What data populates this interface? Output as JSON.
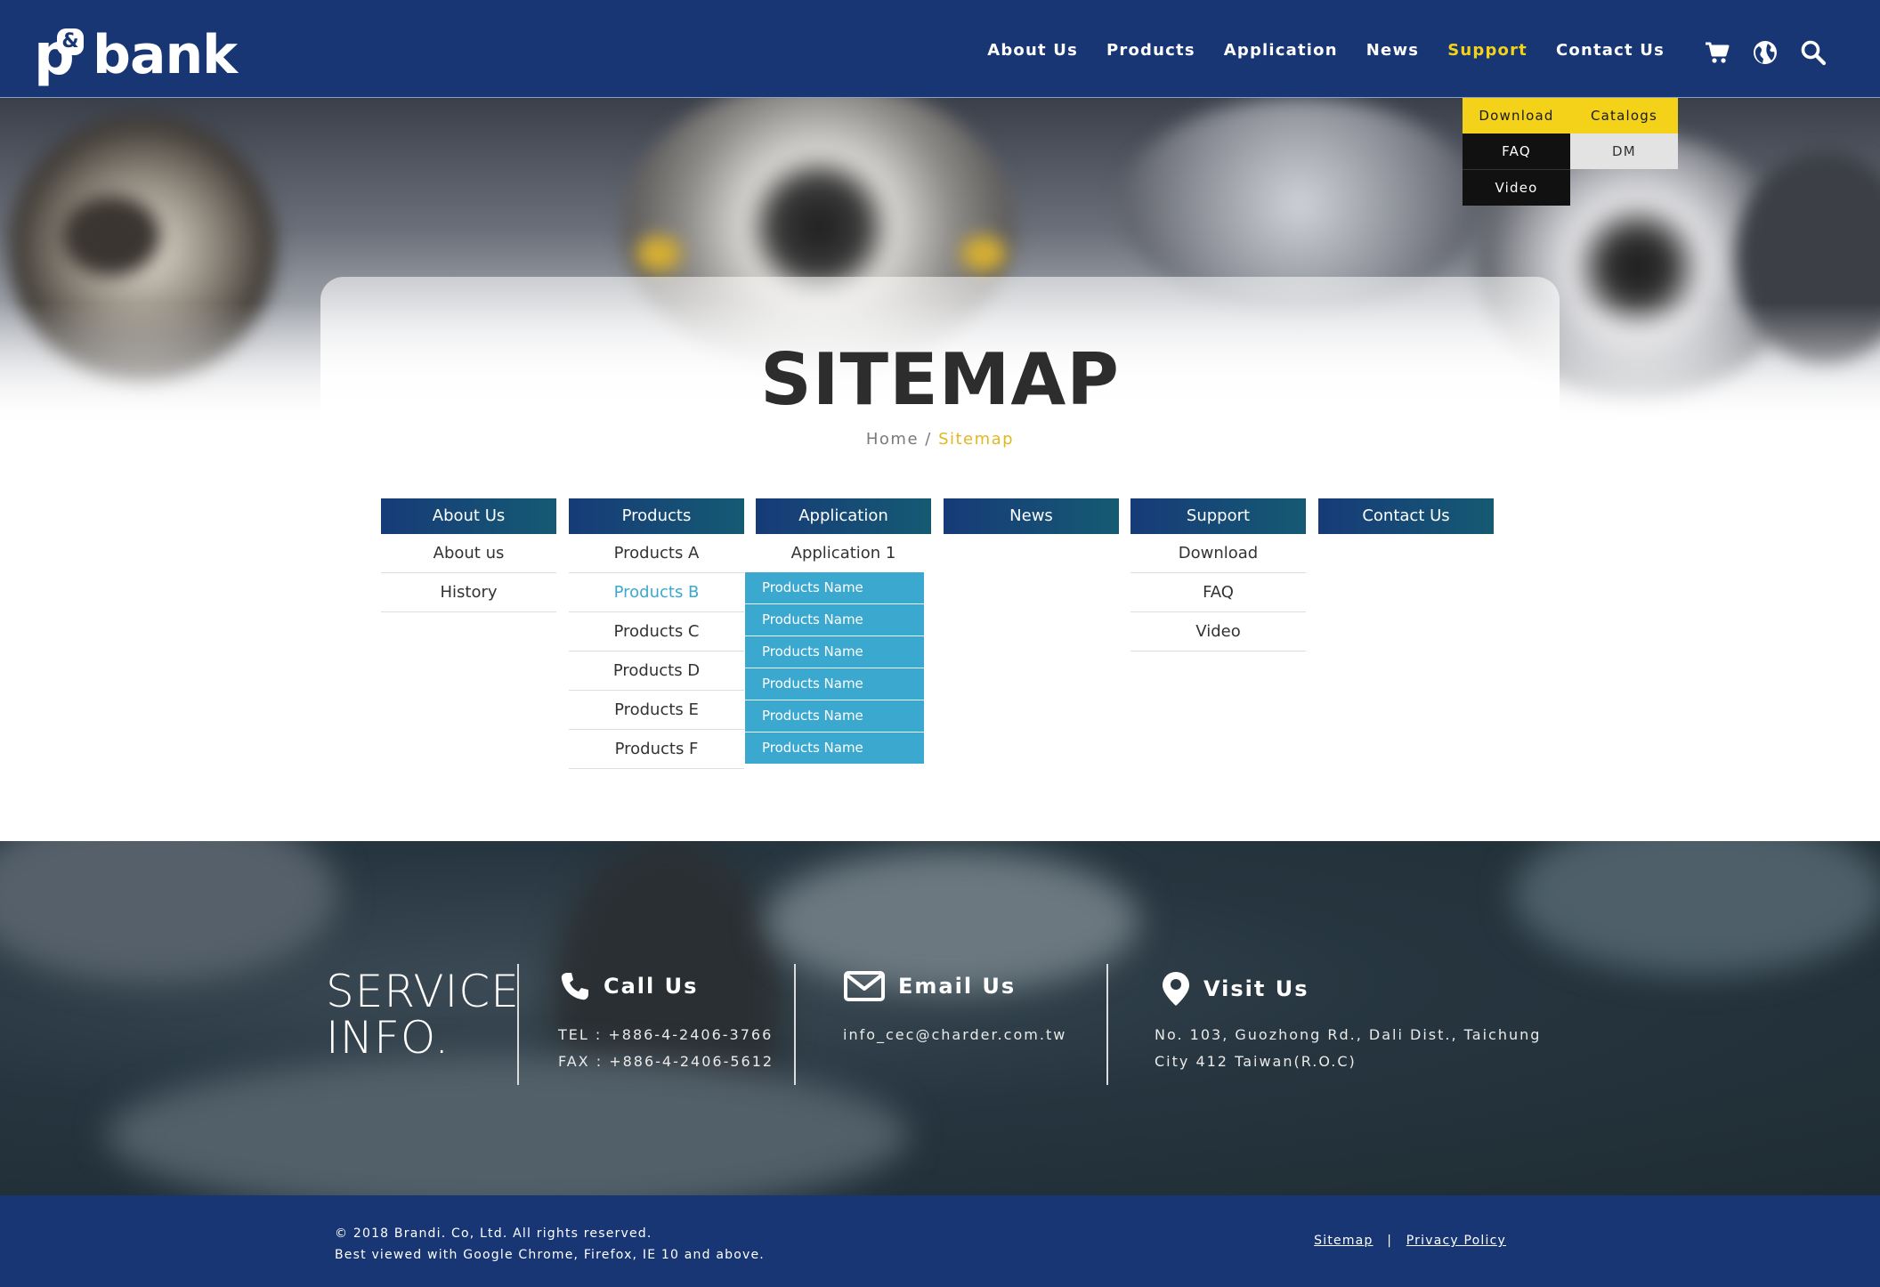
{
  "brand": {
    "logo_text": "bank",
    "logo_p": "p",
    "logo_amp": "&"
  },
  "nav": {
    "items": [
      {
        "label": "About Us"
      },
      {
        "label": "Products"
      },
      {
        "label": "Application"
      },
      {
        "label": "News"
      },
      {
        "label": "Support",
        "active": true
      },
      {
        "label": "Contact Us"
      }
    ],
    "icons": [
      "cart-icon",
      "globe-icon",
      "search-icon"
    ]
  },
  "support_dropdown": {
    "download": "Download",
    "catalogs": "Catalogs",
    "faq": "FAQ",
    "dm": "DM",
    "video": "Video"
  },
  "page": {
    "title": "SITEMAP",
    "breadcrumb_home": "Home",
    "breadcrumb_sep": "/",
    "breadcrumb_current": "Sitemap"
  },
  "sitemap": {
    "about": {
      "head": "About Us",
      "items": [
        "About us",
        "History"
      ]
    },
    "products": {
      "head": "Products",
      "items": [
        "Products A",
        "Products B",
        "Products C",
        "Products D",
        "Products E",
        "Products F"
      ]
    },
    "application": {
      "head": "Application",
      "items": [
        "Application 1"
      ]
    },
    "news": {
      "head": "News"
    },
    "support": {
      "head": "Support",
      "items": [
        "Download",
        "FAQ",
        "Video"
      ]
    },
    "contact": {
      "head": "Contact Us"
    },
    "products_b_submenu": [
      "Products Name",
      "Products Name",
      "Products Name",
      "Products Name",
      "Products Name",
      "Products Name"
    ]
  },
  "service": {
    "title_line1": "SERVICE",
    "title_line2": "INFO.",
    "call": {
      "head": "Call Us",
      "tel": "TEL : +886-4-2406-3766",
      "fax": "FAX : +886-4-2406-5612"
    },
    "email": {
      "head": "Email Us",
      "address": "info_cec@charder.com.tw"
    },
    "visit": {
      "head": "Visit Us",
      "line1": "No. 103, Guozhong Rd., Dali Dist., Taichung",
      "line2": "City 412 Taiwan(R.O.C)"
    }
  },
  "footer": {
    "copyright": "© 2018 Brandi. Co, Ltd. All rights reserved.",
    "browsers": "Best viewed with Google Chrome, Firefox, IE 10 and above.",
    "sitemap_link": "Sitemap",
    "sep": "|",
    "privacy_link": "Privacy Policy"
  },
  "colors": {
    "header_bg": "#173673",
    "accent_yellow": "#f4d21a",
    "submenu_blue": "#3aa8cf",
    "breadcrumb_current": "#e0b820"
  }
}
